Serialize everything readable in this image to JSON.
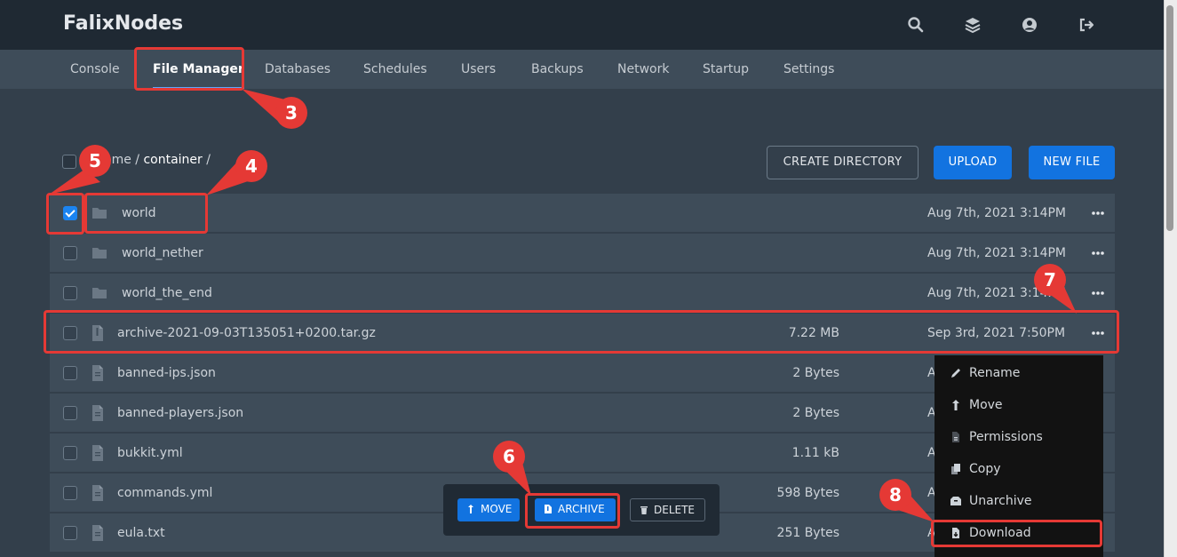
{
  "app": {
    "brand": "FalixNodes"
  },
  "header_icons": [
    "search-icon",
    "layers-icon",
    "account-icon",
    "sign-out-icon"
  ],
  "nav": {
    "tabs": [
      {
        "label": "Console",
        "active": false
      },
      {
        "label": "File Manager",
        "active": true
      },
      {
        "label": "Databases",
        "active": false
      },
      {
        "label": "Schedules",
        "active": false
      },
      {
        "label": "Users",
        "active": false
      },
      {
        "label": "Backups",
        "active": false
      },
      {
        "label": "Network",
        "active": false
      },
      {
        "label": "Startup",
        "active": false
      },
      {
        "label": "Settings",
        "active": false
      }
    ]
  },
  "breadcrumb": {
    "prefix": "ome / ",
    "current": "container",
    "suffix": " /"
  },
  "toolbar": {
    "create_directory": "CREATE DIRECTORY",
    "upload": "UPLOAD",
    "new_file": "NEW FILE"
  },
  "files": [
    {
      "name": "world",
      "type": "folder",
      "size": "",
      "date": "Aug 7th, 2021 3:14PM",
      "checked": true
    },
    {
      "name": "world_nether",
      "type": "folder",
      "size": "",
      "date": "Aug 7th, 2021 3:14PM",
      "checked": false
    },
    {
      "name": "world_the_end",
      "type": "folder",
      "size": "",
      "date": "Aug 7th, 2021 3:14PM",
      "checked": false
    },
    {
      "name": "archive-2021-09-03T135051+0200.tar.gz",
      "type": "archive",
      "size": "7.22 MB",
      "date": "Sep 3rd, 2021 7:50PM",
      "checked": false
    },
    {
      "name": "banned-ips.json",
      "type": "file",
      "size": "2 Bytes",
      "date": "A",
      "checked": false
    },
    {
      "name": "banned-players.json",
      "type": "file",
      "size": "2 Bytes",
      "date": "A",
      "checked": false
    },
    {
      "name": "bukkit.yml",
      "type": "file",
      "size": "1.11 kB",
      "date": "A",
      "checked": false
    },
    {
      "name": "commands.yml",
      "type": "file",
      "size": "598 Bytes",
      "date": "A",
      "checked": false
    },
    {
      "name": "eula.txt",
      "type": "file",
      "size": "251 Bytes",
      "date": "A",
      "checked": false
    }
  ],
  "context_menu": {
    "items": [
      {
        "label": "Rename",
        "icon": "pencil-icon"
      },
      {
        "label": "Move",
        "icon": "move-arrow-icon"
      },
      {
        "label": "Permissions",
        "icon": "permissions-file-icon"
      },
      {
        "label": "Copy",
        "icon": "copy-icon"
      },
      {
        "label": "Unarchive",
        "icon": "unarchive-icon"
      },
      {
        "label": "Download",
        "icon": "download-file-icon"
      }
    ]
  },
  "bulk_actions": {
    "move": "MOVE",
    "archive": "ARCHIVE",
    "delete": "DELETE"
  },
  "annotations": [
    "3",
    "4",
    "5",
    "6",
    "7",
    "8"
  ],
  "colors": {
    "header_bg": "#1f2933",
    "nav_bg": "#3e4c59",
    "page_bg": "#333f4b",
    "row_bg": "#3e4c59",
    "primary": "#1273e0",
    "annotation": "#e53935",
    "menu_bg": "#121212"
  }
}
